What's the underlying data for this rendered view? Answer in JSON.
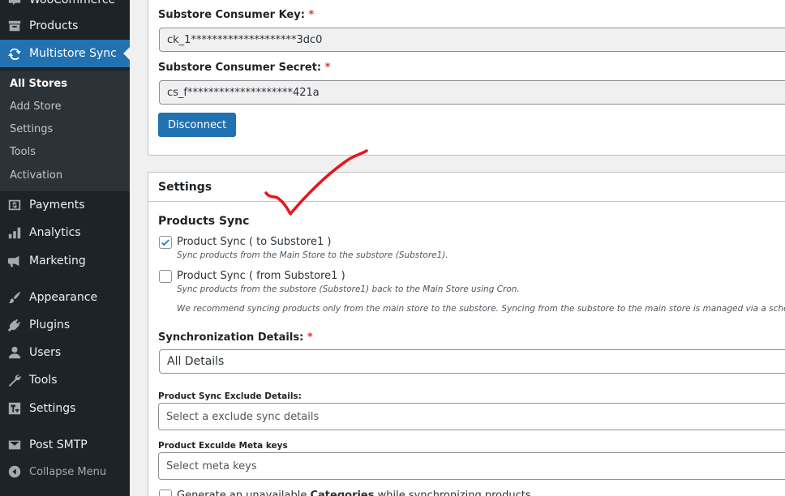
{
  "sidebar": {
    "items": [
      {
        "label": "WooCommerce",
        "icon": "woocommerce-icon"
      },
      {
        "label": "Products",
        "icon": "archive-icon"
      },
      {
        "label": "Multistore Sync",
        "icon": "sync-icon"
      },
      {
        "label": "Payments",
        "icon": "payments-icon"
      },
      {
        "label": "Analytics",
        "icon": "bar-chart-icon"
      },
      {
        "label": "Marketing",
        "icon": "megaphone-icon"
      },
      {
        "label": "Appearance",
        "icon": "paintbrush-icon"
      },
      {
        "label": "Plugins",
        "icon": "plug-icon"
      },
      {
        "label": "Users",
        "icon": "user-icon"
      },
      {
        "label": "Tools",
        "icon": "wrench-icon"
      },
      {
        "label": "Settings",
        "icon": "settings-icon"
      },
      {
        "label": "Post SMTP",
        "icon": "email-icon"
      }
    ],
    "submenu": [
      "All Stores",
      "Add Store",
      "Settings",
      "Tools",
      "Activation"
    ],
    "collapse_label": "Collapse Menu"
  },
  "connection": {
    "key_label": "Substore Consumer Key:",
    "key_value": "ck_1********************3dc0",
    "secret_label": "Substore Consumer Secret:",
    "secret_value": "cs_f********************421a",
    "required_mark": "*",
    "disconnect_label": "Disconnect"
  },
  "settings": {
    "title": "Settings",
    "products_sync_heading": "Products Sync",
    "sync_to_label": "Product Sync ( to Substore1 )",
    "sync_to_checked": true,
    "sync_to_desc": "Sync products from the Main Store to the substore (Substore1).",
    "sync_from_label": "Product Sync ( from Substore1 )",
    "sync_from_checked": false,
    "sync_from_desc": "Sync products from the substore (Substore1) back to the Main Store using Cron.",
    "recommend_note": "We recommend syncing products only from the main store to the substore. Syncing from the substore to the main store is managed via a scheduler that runs",
    "sync_details_label": "Synchronization Details:",
    "sync_details_value": "All Details",
    "exclude_details_label": "Product Sync Exclude Details:",
    "exclude_details_placeholder": "Select a exclude sync details",
    "exclude_meta_label": "Product Exculde Meta keys",
    "exclude_meta_placeholder": "Select meta keys",
    "generate_label_pre": "Generate an unavailable ",
    "generate_label_bold": "Categories",
    "generate_label_post": " while synchronizing products"
  },
  "colors": {
    "accent": "#2271b1",
    "sidebar_bg": "#1d2327",
    "required": "#d63638",
    "annotation": "#e8161b"
  }
}
